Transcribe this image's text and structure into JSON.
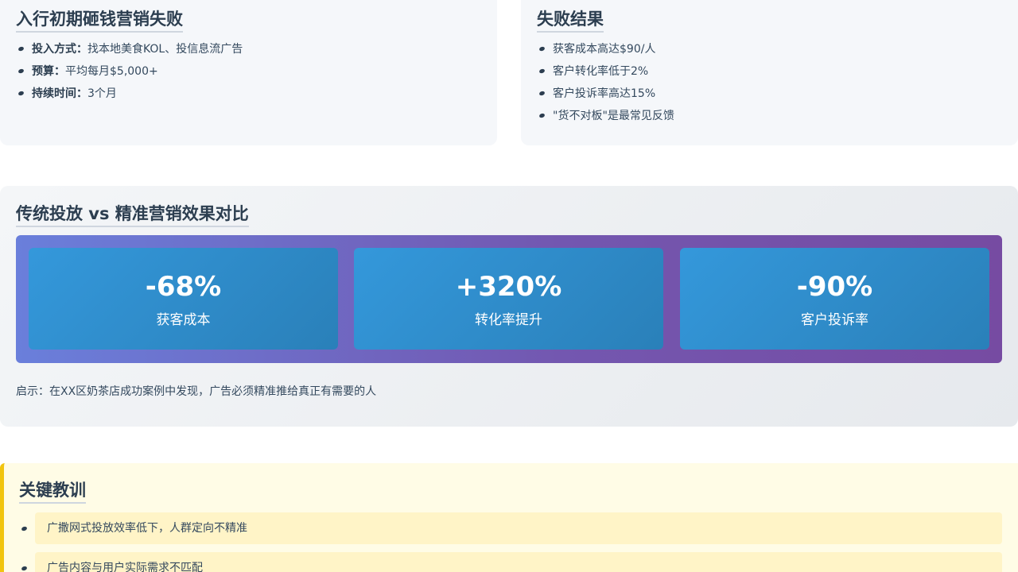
{
  "early_spending": {
    "title": "入行初期砸钱营销失败",
    "items": [
      {
        "label": "投入方式：",
        "value": "找本地美食KOL、投信息流广告"
      },
      {
        "label": "预算：",
        "value": "平均每月$5,000+"
      },
      {
        "label": "持续时间：",
        "value": "3个月"
      }
    ]
  },
  "failure_results": {
    "title": "失败结果",
    "items": [
      "获客成本高达$90/人",
      "客户转化率低于2%",
      "客户投诉率高达15%",
      "\"货不对板\"是最常见反馈"
    ]
  },
  "comparison": {
    "title": "传统投放 vs 精准营销效果对比",
    "stats": [
      {
        "value": "-68%",
        "label": "获客成本"
      },
      {
        "value": "+320%",
        "label": "转化率提升"
      },
      {
        "value": "-90%",
        "label": "客户投诉率"
      }
    ],
    "insight": "启示：在XX区奶茶店成功案例中发现，广告必须精准推给真正有需要的人"
  },
  "lessons": {
    "title": "关键教训",
    "items": [
      "广撒网式投放效率低下，人群定向不精准",
      "广告内容与用户实际需求不匹配"
    ]
  },
  "colors": {
    "heading": "#2c3e50",
    "stat_card": "#3498db",
    "band_start": "#6a7fdb",
    "band_end": "#764ba2",
    "lesson_accent": "#f1c40f"
  }
}
